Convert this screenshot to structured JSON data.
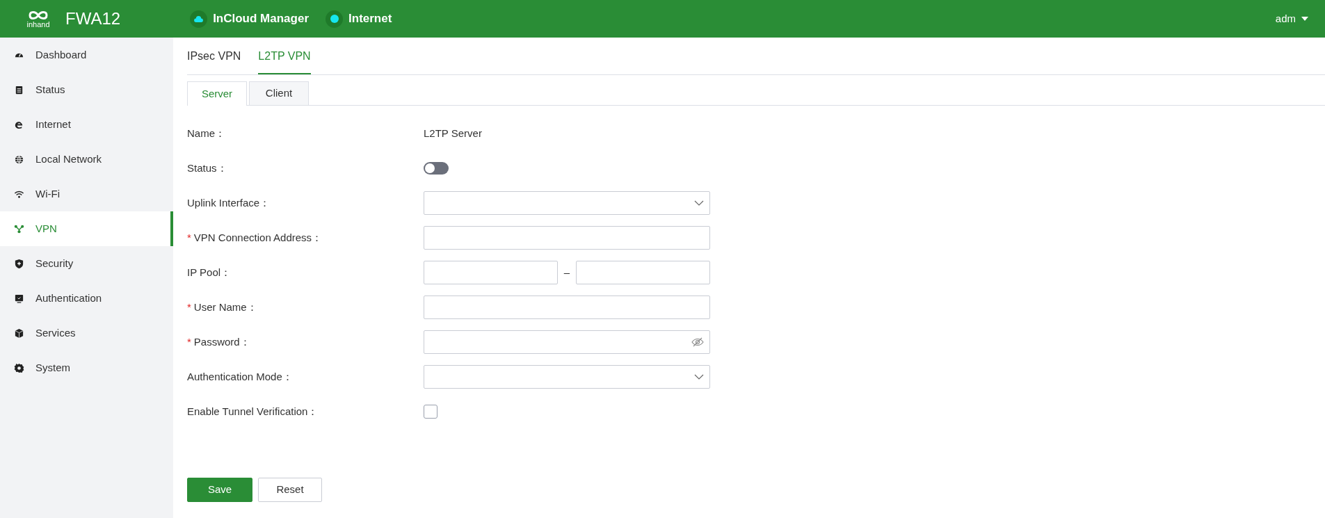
{
  "header": {
    "brand": "inhand",
    "product": "FWA12",
    "indicators": [
      {
        "kind": "cloud",
        "label": "InCloud Manager"
      },
      {
        "kind": "dot",
        "label": "Internet"
      }
    ],
    "user": "adm"
  },
  "sidebar": {
    "items": [
      {
        "label": "Dashboard",
        "selected": false
      },
      {
        "label": "Status",
        "selected": false
      },
      {
        "label": "Internet",
        "selected": false
      },
      {
        "label": "Local Network",
        "selected": false
      },
      {
        "label": "Wi-Fi",
        "selected": false
      },
      {
        "label": "VPN",
        "selected": true
      },
      {
        "label": "Security",
        "selected": false
      },
      {
        "label": "Authentication",
        "selected": false
      },
      {
        "label": "Services",
        "selected": false
      },
      {
        "label": "System",
        "selected": false
      }
    ]
  },
  "tabs": [
    {
      "label": "IPsec VPN",
      "selected": false
    },
    {
      "label": "L2TP VPN",
      "selected": true
    }
  ],
  "subtabs": [
    {
      "label": "Server",
      "selected": true
    },
    {
      "label": "Client",
      "selected": false
    }
  ],
  "form": {
    "fields": [
      {
        "kind": "text",
        "label": "Name：",
        "value": "L2TP Server"
      },
      {
        "kind": "toggle",
        "label": "Status：",
        "on": false
      },
      {
        "kind": "select",
        "label": "Uplink Interface："
      },
      {
        "kind": "input",
        "required_mark": "*",
        "label": "VPN Connection Address："
      },
      {
        "kind": "range",
        "label": "IP Pool：",
        "separator": "–"
      },
      {
        "kind": "input",
        "required_mark": "*",
        "label": "User Name："
      },
      {
        "kind": "password",
        "required_mark": "*",
        "label": "Password："
      },
      {
        "kind": "select",
        "label": "Authentication Mode："
      },
      {
        "kind": "checkbox",
        "label": "Enable Tunnel Verification：",
        "checked": false
      }
    ]
  },
  "buttons": [
    {
      "kind": "primary",
      "label": "Save"
    },
    {
      "kind": "secondary",
      "label": "Reset"
    }
  ]
}
